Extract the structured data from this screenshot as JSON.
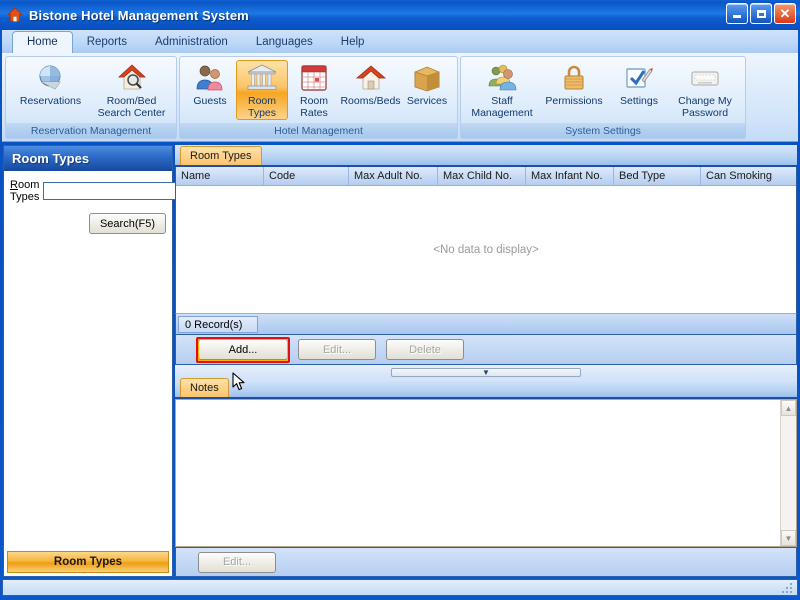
{
  "window": {
    "title": "Bistone Hotel Management System",
    "icon": "house-icon",
    "buttons": {
      "minimize": "minimize-button",
      "maximize": "maximize-button",
      "close": "close-button"
    }
  },
  "menu": {
    "tabs": [
      {
        "label": "Home",
        "active": true
      },
      {
        "label": "Reports",
        "active": false
      },
      {
        "label": "Administration",
        "active": false
      },
      {
        "label": "Languages",
        "active": false
      },
      {
        "label": "Help",
        "active": false
      }
    ]
  },
  "ribbon": {
    "groups": [
      {
        "title": "Reservation Management",
        "items": [
          {
            "label": "Reservations",
            "icon": "globe-icon",
            "selected": false
          },
          {
            "label": "Room/Bed\nSearch Center",
            "icon": "house-magnifier-icon",
            "selected": false
          }
        ]
      },
      {
        "title": "Hotel Management",
        "items": [
          {
            "label": "Guests",
            "icon": "people-icon",
            "selected": false
          },
          {
            "label": "Room\nTypes",
            "icon": "bank-building-icon",
            "selected": true
          },
          {
            "label": "Room\nRates",
            "icon": "calendar-icon",
            "selected": false
          },
          {
            "label": "Rooms/Beds",
            "icon": "house-icon",
            "selected": false
          },
          {
            "label": "Services",
            "icon": "box-icon",
            "selected": false
          }
        ]
      },
      {
        "title": "System Settings",
        "items": [
          {
            "label": "Staff\nManagement",
            "icon": "group-icon",
            "selected": false
          },
          {
            "label": "Permissions",
            "icon": "padlock-icon",
            "selected": false
          },
          {
            "label": "Settings",
            "icon": "checkbox-pen-icon",
            "selected": false
          },
          {
            "label": "Change My\nPassword",
            "icon": "keyboard-icon",
            "selected": false
          }
        ]
      }
    ]
  },
  "sidebar": {
    "header": "Room Types",
    "search_label": "Room Types",
    "search_value": "",
    "search_placeholder": "",
    "search_button": "Search(F5)",
    "nav_button": "Room Types"
  },
  "main": {
    "tab": "Room Types",
    "grid": {
      "columns": [
        "Name",
        "Code",
        "Max Adult No.",
        "Max Child No.",
        "Max Infant No.",
        "Bed Type",
        "Can Smoking"
      ],
      "rows": [],
      "empty_message": "<No data to display>"
    },
    "record_count": "0 Record(s)",
    "buttons": [
      {
        "label": "Add...",
        "enabled": true,
        "highlighted": true
      },
      {
        "label": "Edit...",
        "enabled": false,
        "highlighted": false
      },
      {
        "label": "Delete",
        "enabled": false,
        "highlighted": false
      }
    ],
    "splitter_glyph": "chevron-down-icon",
    "notes": {
      "tab": "Notes",
      "text": "",
      "edit_button": "Edit..."
    }
  },
  "statusbar": {
    "text": ""
  },
  "colors": {
    "titlebar_blue": "#0a56c6",
    "accent_orange": "#f7a521",
    "highlight_red": "#e01010",
    "selected_tab": "#fbc46c",
    "grid_header": "#c9dcf5"
  }
}
